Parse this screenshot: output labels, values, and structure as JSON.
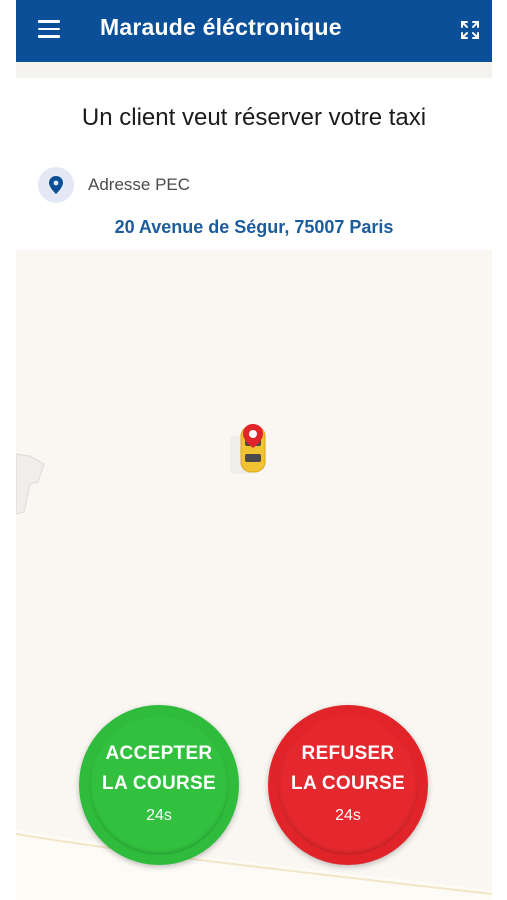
{
  "app_bar": {
    "title": "Maraude éléctronique",
    "menu_icon": "hamburger-menu-icon",
    "expand_icon": "fullscreen-expand-icon",
    "color": "#0b4f98"
  },
  "request": {
    "headline": "Un client veut réserver votre taxi",
    "address_label": "Adresse PEC",
    "address_icon": "location-pin-icon",
    "address_value": "20 Avenue de Ségur, 75007 Paris"
  },
  "map": {
    "marker_icon": "taxi-car-icon",
    "pin_icon": "red-map-pin-icon"
  },
  "actions": {
    "accept": {
      "line1": "ACCEPTER",
      "line2": "LA COURSE",
      "timer": "24s",
      "color": "#2fbb3c"
    },
    "refuse": {
      "line1": "REFUSER",
      "line2": "LA COURSE",
      "timer": "24s",
      "color": "#e0242a"
    }
  }
}
